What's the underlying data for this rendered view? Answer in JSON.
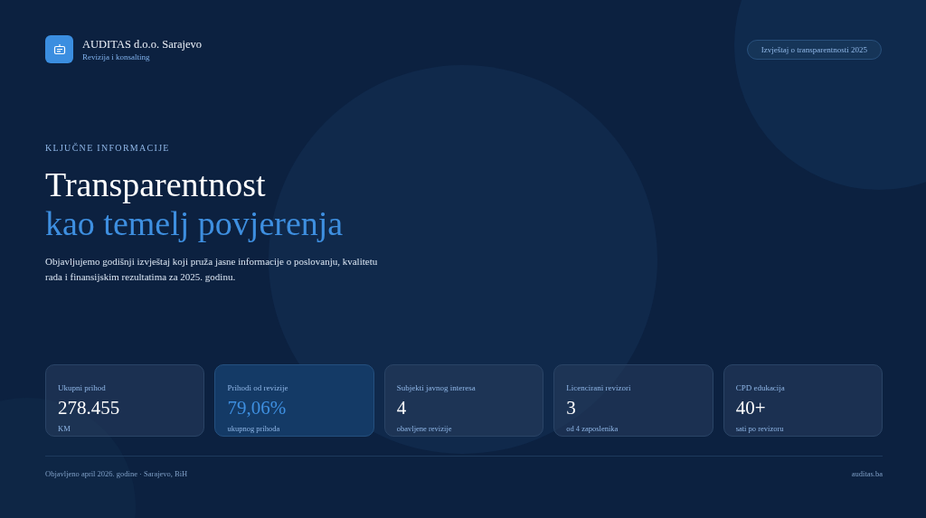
{
  "brand": {
    "name": "AUDITAS d.o.o. Sarajevo",
    "tagline": "Revizija i konsalting"
  },
  "header_button": "Izvještaj o transparentnosti 2025",
  "hero": {
    "eyebrow": "KLJUČNE INFORMACIJE",
    "title_line_1": "Transparentnost",
    "title_line_2": "kao temelj povjerenja",
    "description": "Objavljujemo godišnji izvještaj koji pruža jasne informacije o poslovanju, kvalitetu rada i finansijskim rezultatima za 2025. godinu."
  },
  "stats": [
    {
      "label": "Ukupni prihod",
      "value": "278.455",
      "note": "KM",
      "highlighted": false
    },
    {
      "label": "Prihodi od revizije",
      "value": "79,06%",
      "note": "ukupnog prihoda",
      "highlighted": true
    },
    {
      "label": "Subjekti javnog interesa",
      "value": "4",
      "note": "obavljene revizije",
      "highlighted": false
    },
    {
      "label": "Licencirani revizori",
      "value": "3",
      "note": "od 4 zaposlenika",
      "highlighted": false
    },
    {
      "label": "CPD edukacija",
      "value": "40+",
      "note": "sati po revizoru",
      "highlighted": false
    }
  ],
  "footer": {
    "published": "Objavljeno april 2026. godine · Sarajevo, BiH",
    "site": "auditas.ba"
  }
}
